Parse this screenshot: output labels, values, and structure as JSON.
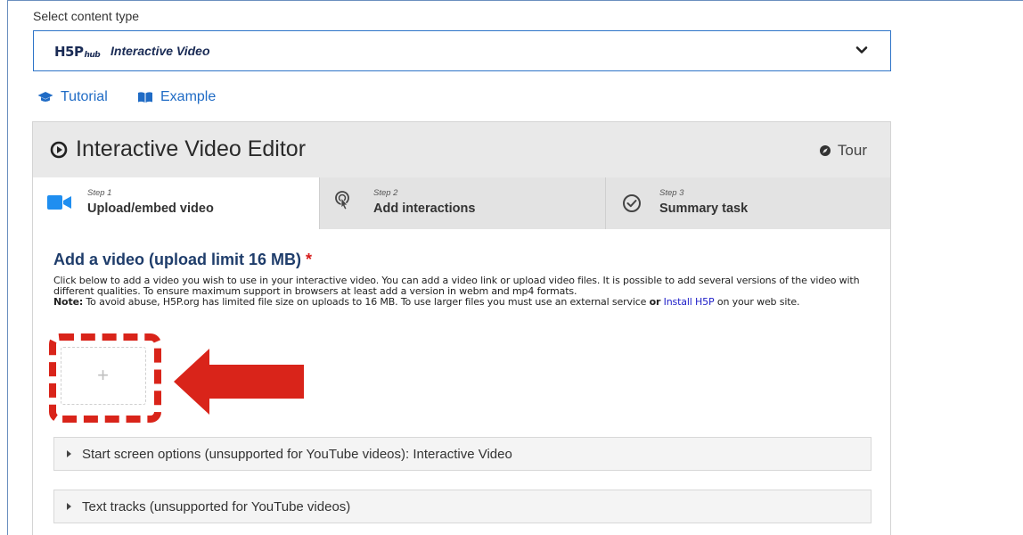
{
  "content_type": {
    "label": "Select content type",
    "logo_main": "H5P",
    "logo_sub": "hub",
    "selected": "Interactive Video",
    "icon": "chevron-down-icon"
  },
  "links": [
    {
      "label": "Tutorial",
      "icon": "graduation-cap-icon"
    },
    {
      "label": "Example",
      "icon": "book-icon"
    }
  ],
  "editor": {
    "title": "Interactive Video Editor",
    "title_icon": "play-circle-icon",
    "tour_label": "Tour",
    "tour_icon": "compass-icon",
    "steps": [
      {
        "number": "Step 1",
        "label": "Upload/embed video",
        "icon": "video-camera-icon",
        "active": true
      },
      {
        "number": "Step 2",
        "label": "Add interactions",
        "icon": "tap-pointer-icon",
        "active": false
      },
      {
        "number": "Step 3",
        "label": "Summary task",
        "icon": "check-circle-icon",
        "active": false
      }
    ]
  },
  "upload": {
    "heading": "Add a video (upload limit 16 MB)",
    "required_mark": "*",
    "description_1": "Click below to add a video you wish to use in your interactive video. You can add a video link or upload video files. It is possible to add several versions of the video with different qualities. To ensure maximum support in browsers at least add a version in webm and mp4 formats.",
    "note_label": "Note:",
    "note_text_1": " To avoid abuse, H5P.org has limited file size on uploads to 16 MB. To use larger files you must use an external service ",
    "note_or": "or",
    "note_link": "Install H5P",
    "note_text_2": " on your web site.",
    "add_symbol": "+"
  },
  "accordions": [
    {
      "label": "Start screen options (unsupported for YouTube videos): Interactive Video"
    },
    {
      "label": "Text tracks (unsupported for YouTube videos)"
    }
  ],
  "colors": {
    "link_blue": "#1f6bc5",
    "heading_navy": "#1f3d6b",
    "highlight_red": "#d9241a",
    "step1_icon_blue": "#1f8ef0"
  }
}
